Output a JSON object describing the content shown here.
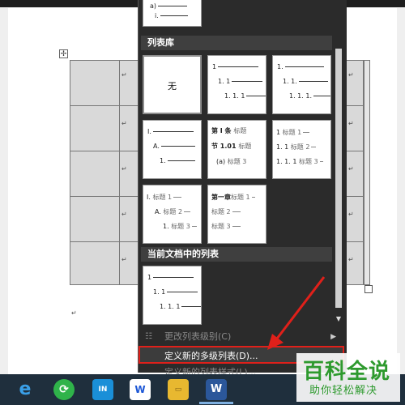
{
  "top_tile": {
    "lines": [
      "a)",
      "i."
    ]
  },
  "sections": {
    "library": "列表库",
    "current": "当前文档中的列表"
  },
  "tiles": {
    "none": "无",
    "t2": [
      "1",
      "1. 1",
      "1. 1. 1"
    ],
    "t3": [
      "1.",
      "1. 1.",
      "1. 1. 1."
    ],
    "t4": [
      "I.",
      "A.",
      "1."
    ],
    "t5": {
      "l1a": "第 I 条",
      "l1b": "标题",
      "l2a": "节 1.01",
      "l2b": "标题",
      "l3a": "(a)",
      "l3b": "标题 3"
    },
    "t6": {
      "l1a": "1",
      "l1b": "标题 1",
      "l2a": "1. 1",
      "l2b": "标题 2",
      "l3a": "1. 1. 1",
      "l3b": "标题 3"
    },
    "t7": {
      "l1a": "I.",
      "l1b": "标题 1",
      "l2a": "A.",
      "l2b": "标题 2",
      "l3a": "1.",
      "l3b": "标题 3"
    },
    "t8": {
      "l1a": "第一章",
      "l1b": "标题 1",
      "l2b": "标题 2",
      "l3b": "标题 3"
    },
    "current": [
      "1",
      "1. 1",
      "1. 1. 1"
    ]
  },
  "menu": {
    "change_level": "更改列表级别(C)",
    "define_new": "定义新的多级列表(D)...",
    "define_style": "定义新的列表样式(L)..."
  },
  "document": {
    "move_handle": "✢",
    "pilcrow": "↵"
  },
  "taskbar": {
    "edge": "e",
    "browser360": "⟳",
    "app3": "IN",
    "wps": "W",
    "folder": "▭",
    "word": "W"
  },
  "watermark": {
    "title": "百科全说",
    "subtitle": "助你轻松解决"
  },
  "colors": {
    "highlight_border": "#e0201a",
    "watermark_green": "#2e9a2e",
    "menu_bg": "#2b2b2b",
    "taskbar_bg": "#1f2f3d"
  }
}
